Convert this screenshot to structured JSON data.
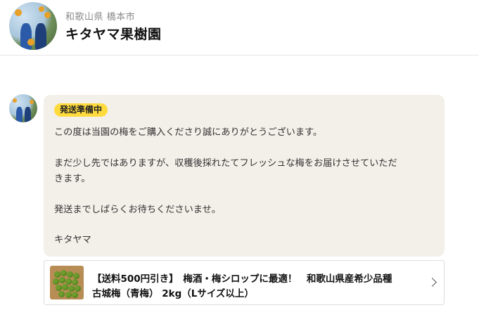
{
  "shop": {
    "location": "和歌山県 橋本市",
    "name": "キタヤマ果樹園"
  },
  "message": {
    "status_badge": "発送準備中",
    "lines": [
      "この度は当園の梅をご購入くださり誠にありがとうございます。",
      "まだ少し先ではありますが、収穫後採れたてフレッシュな梅をお届けさせていただ",
      "きます。",
      "発送までしばらくお待ちくださいませ。",
      "キタヤマ"
    ]
  },
  "product": {
    "title_line1": "【送料500円引き】　梅酒・梅シロップに最適！　和歌山県産希少品種",
    "title_line2": "古城梅（青梅） 2kg（Lサイズ以上）"
  },
  "colors": {
    "badge": "#ffdb3d",
    "bubble": "#f3efe9"
  }
}
